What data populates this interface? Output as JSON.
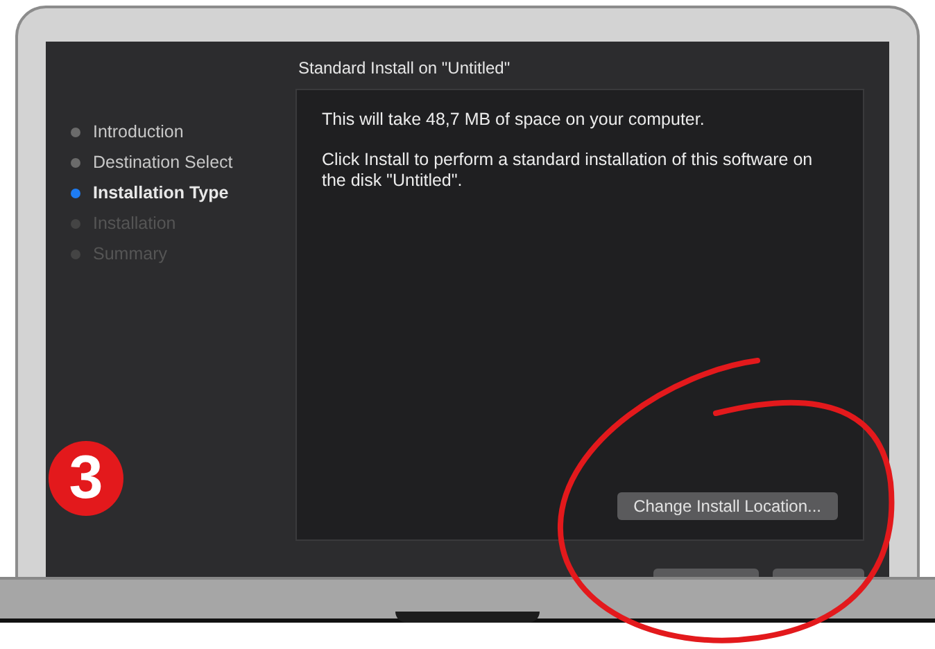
{
  "window": {
    "title": "Standard Install on \"Untitled\""
  },
  "steps": [
    {
      "label": "Introduction",
      "selected": false,
      "disabled": false
    },
    {
      "label": "Destination Select",
      "selected": false,
      "disabled": false
    },
    {
      "label": "Installation Type",
      "selected": true,
      "disabled": false
    },
    {
      "label": "Installation",
      "selected": false,
      "disabled": true
    },
    {
      "label": "Summary",
      "selected": false,
      "disabled": true
    }
  ],
  "content": {
    "paragraphs": [
      "This will take 48,7 MB of space on your computer.",
      "Click Install to perform a standard installation of this software on the disk \"Untitled\"."
    ],
    "location_button": "Change Install Location..."
  },
  "step_badge": "3"
}
